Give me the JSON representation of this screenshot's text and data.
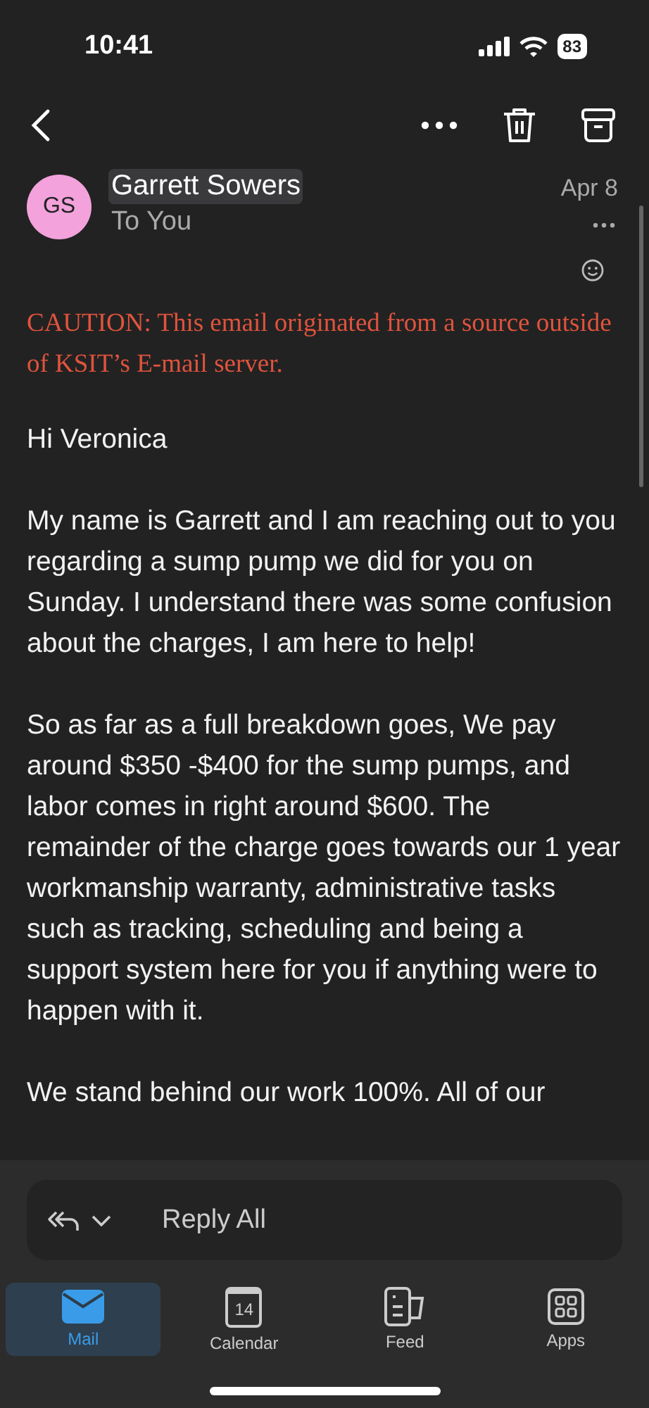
{
  "status_bar": {
    "time": "10:41",
    "battery": "83"
  },
  "toolbar": {
    "actions": [
      {
        "kind": "more"
      },
      {
        "kind": "delete"
      },
      {
        "kind": "archive"
      }
    ]
  },
  "message": {
    "sender_initials": "GS",
    "sender": "Garrett Sowers",
    "recipients": "To You",
    "date": "Apr 8",
    "caution": "CAUTION: This email originated from a source outside of KSIT’s E-mail server.",
    "paragraphs": [
      "Hi Veronica",
      "My name is Garrett and I am reaching out to you regarding a sump pump we did for you on Sunday. I understand there was some confusion about the charges, I am here to help!",
      "So as far as a full breakdown goes, We pay around $350 -$400 for the sump pumps, and labor comes in right around $600. The remainder of the charge goes towards our 1 year workmanship warranty, administrative tasks such as tracking, scheduling and being a support system here for you if anything were to happen with it.",
      "We stand behind our work 100%. All of our"
    ]
  },
  "reply": {
    "label": "Reply All"
  },
  "tabs": [
    {
      "label": "Mail",
      "kind": "mail",
      "selected": true
    },
    {
      "label": "Calendar",
      "kind": "calendar",
      "day": "14",
      "selected": false
    },
    {
      "label": "Feed",
      "kind": "feed",
      "selected": false
    },
    {
      "label": "Apps",
      "kind": "apps",
      "selected": false
    }
  ]
}
